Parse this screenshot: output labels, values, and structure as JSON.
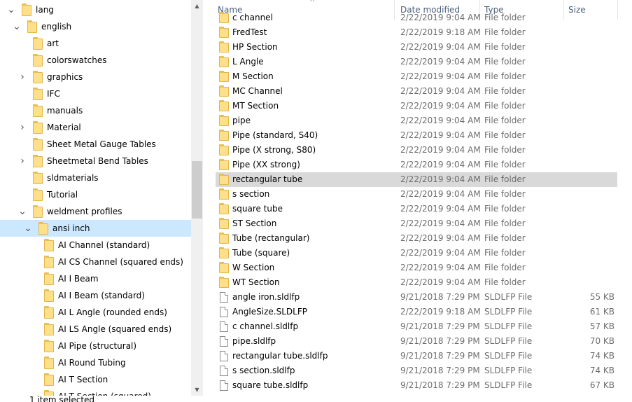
{
  "nav": {
    "items": [
      {
        "label": "lang",
        "level": 0,
        "chevron": "down",
        "selected": false
      },
      {
        "label": "english",
        "level": 1,
        "chevron": "down",
        "selected": false
      },
      {
        "label": "art",
        "level": 2,
        "chevron": "none",
        "selected": false
      },
      {
        "label": "colorswatches",
        "level": 2,
        "chevron": "none",
        "selected": false
      },
      {
        "label": "graphics",
        "level": 2,
        "chevron": "right",
        "selected": false
      },
      {
        "label": "IFC",
        "level": 2,
        "chevron": "none",
        "selected": false
      },
      {
        "label": "manuals",
        "level": 2,
        "chevron": "none",
        "selected": false
      },
      {
        "label": "Material",
        "level": 2,
        "chevron": "right",
        "selected": false
      },
      {
        "label": "Sheet Metal Gauge Tables",
        "level": 2,
        "chevron": "none",
        "selected": false
      },
      {
        "label": "Sheetmetal Bend Tables",
        "level": 2,
        "chevron": "right",
        "selected": false
      },
      {
        "label": "sldmaterials",
        "level": 2,
        "chevron": "none",
        "selected": false
      },
      {
        "label": "Tutorial",
        "level": 2,
        "chevron": "none",
        "selected": false
      },
      {
        "label": "weldment profiles",
        "level": 2,
        "chevron": "down",
        "selected": false
      },
      {
        "label": "ansi inch",
        "level": 3,
        "chevron": "down",
        "selected": true
      },
      {
        "label": "AI Channel (standard)",
        "level": 4,
        "chevron": "none",
        "selected": false
      },
      {
        "label": "AI CS Channel (squared ends)",
        "level": 4,
        "chevron": "none",
        "selected": false
      },
      {
        "label": "AI I Beam",
        "level": 4,
        "chevron": "none",
        "selected": false
      },
      {
        "label": "AI I Beam (standard)",
        "level": 4,
        "chevron": "none",
        "selected": false
      },
      {
        "label": "AI L Angle (rounded ends)",
        "level": 4,
        "chevron": "none",
        "selected": false
      },
      {
        "label": "AI LS Angle (squared ends)",
        "level": 4,
        "chevron": "none",
        "selected": false
      },
      {
        "label": "AI Pipe (structural)",
        "level": 4,
        "chevron": "none",
        "selected": false
      },
      {
        "label": "AI Round Tubing",
        "level": 4,
        "chevron": "none",
        "selected": false
      },
      {
        "label": "AI T Section",
        "level": 4,
        "chevron": "none",
        "selected": false
      },
      {
        "label": "AI T Section (squared)",
        "level": 4,
        "chevron": "none",
        "selected": false
      }
    ]
  },
  "status": {
    "text": "1 item selected"
  },
  "columns": {
    "name": "Name",
    "date": "Date modified",
    "type": "Type",
    "size": "Size"
  },
  "files": [
    {
      "name": "c channel",
      "date": "2/22/2019 9:04 AM",
      "type": "File folder",
      "size": "",
      "kind": "folder",
      "selected": false
    },
    {
      "name": "FredTest",
      "date": "2/22/2019 9:18 AM",
      "type": "File folder",
      "size": "",
      "kind": "folder",
      "selected": false
    },
    {
      "name": "HP Section",
      "date": "2/22/2019 9:04 AM",
      "type": "File folder",
      "size": "",
      "kind": "folder",
      "selected": false
    },
    {
      "name": "L Angle",
      "date": "2/22/2019 9:04 AM",
      "type": "File folder",
      "size": "",
      "kind": "folder",
      "selected": false
    },
    {
      "name": "M Section",
      "date": "2/22/2019 9:04 AM",
      "type": "File folder",
      "size": "",
      "kind": "folder",
      "selected": false
    },
    {
      "name": "MC Channel",
      "date": "2/22/2019 9:04 AM",
      "type": "File folder",
      "size": "",
      "kind": "folder",
      "selected": false
    },
    {
      "name": "MT Section",
      "date": "2/22/2019 9:04 AM",
      "type": "File folder",
      "size": "",
      "kind": "folder",
      "selected": false
    },
    {
      "name": "pipe",
      "date": "2/22/2019 9:04 AM",
      "type": "File folder",
      "size": "",
      "kind": "folder",
      "selected": false
    },
    {
      "name": "Pipe (standard, S40)",
      "date": "2/22/2019 9:04 AM",
      "type": "File folder",
      "size": "",
      "kind": "folder",
      "selected": false
    },
    {
      "name": "Pipe (X strong, S80)",
      "date": "2/22/2019 9:04 AM",
      "type": "File folder",
      "size": "",
      "kind": "folder",
      "selected": false
    },
    {
      "name": "Pipe (XX strong)",
      "date": "2/22/2019 9:04 AM",
      "type": "File folder",
      "size": "",
      "kind": "folder",
      "selected": false
    },
    {
      "name": "rectangular tube",
      "date": "2/22/2019 9:04 AM",
      "type": "File folder",
      "size": "",
      "kind": "folder",
      "selected": true
    },
    {
      "name": "s section",
      "date": "2/22/2019 9:04 AM",
      "type": "File folder",
      "size": "",
      "kind": "folder",
      "selected": false
    },
    {
      "name": "square tube",
      "date": "2/22/2019 9:04 AM",
      "type": "File folder",
      "size": "",
      "kind": "folder",
      "selected": false
    },
    {
      "name": "ST Section",
      "date": "2/22/2019 9:04 AM",
      "type": "File folder",
      "size": "",
      "kind": "folder",
      "selected": false
    },
    {
      "name": "Tube (rectangular)",
      "date": "2/22/2019 9:04 AM",
      "type": "File folder",
      "size": "",
      "kind": "folder",
      "selected": false
    },
    {
      "name": "Tube (square)",
      "date": "2/22/2019 9:04 AM",
      "type": "File folder",
      "size": "",
      "kind": "folder",
      "selected": false
    },
    {
      "name": "W Section",
      "date": "2/22/2019 9:04 AM",
      "type": "File folder",
      "size": "",
      "kind": "folder",
      "selected": false
    },
    {
      "name": "WT Section",
      "date": "2/22/2019 9:04 AM",
      "type": "File folder",
      "size": "",
      "kind": "folder",
      "selected": false
    },
    {
      "name": "angle iron.sldlfp",
      "date": "9/21/2018 7:29 PM",
      "type": "SLDLFP File",
      "size": "55 KB",
      "kind": "file",
      "selected": false
    },
    {
      "name": "AngleSize.SLDLFP",
      "date": "2/22/2019 9:18 AM",
      "type": "SLDLFP File",
      "size": "61 KB",
      "kind": "file",
      "selected": false
    },
    {
      "name": "c channel.sldlfp",
      "date": "9/21/2018 7:29 PM",
      "type": "SLDLFP File",
      "size": "57 KB",
      "kind": "file",
      "selected": false
    },
    {
      "name": "pipe.sldlfp",
      "date": "9/21/2018 7:29 PM",
      "type": "SLDLFP File",
      "size": "70 KB",
      "kind": "file",
      "selected": false
    },
    {
      "name": "rectangular tube.sldlfp",
      "date": "9/21/2018 7:29 PM",
      "type": "SLDLFP File",
      "size": "74 KB",
      "kind": "file",
      "selected": false
    },
    {
      "name": "s section.sldlfp",
      "date": "9/21/2018 7:29 PM",
      "type": "SLDLFP File",
      "size": "74 KB",
      "kind": "file",
      "selected": false
    },
    {
      "name": "square tube.sldlfp",
      "date": "9/21/2018 7:29 PM",
      "type": "SLDLFP File",
      "size": "67 KB",
      "kind": "file",
      "selected": false
    }
  ]
}
